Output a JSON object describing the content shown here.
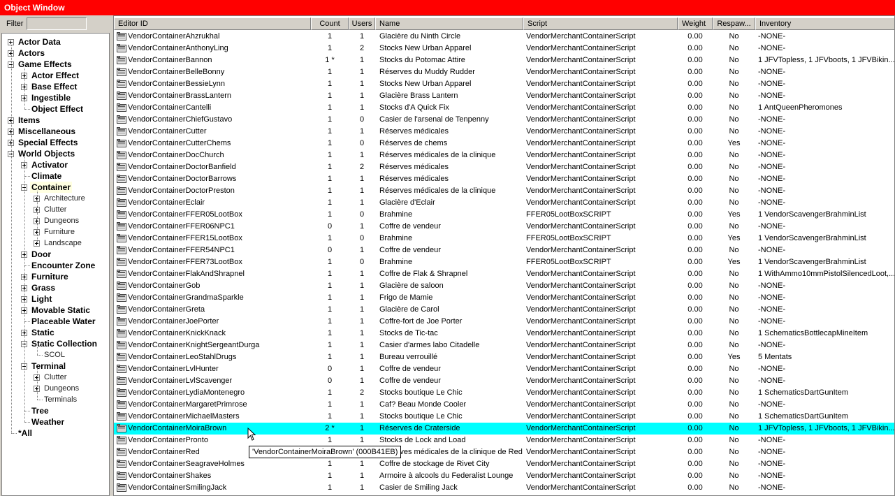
{
  "window": {
    "title": "Object Window"
  },
  "filter": {
    "label": "Filter",
    "value": ""
  },
  "tree": [
    {
      "label": "Actor Data",
      "level": 0,
      "expander": "plus"
    },
    {
      "label": "Actors",
      "level": 0,
      "expander": "plus"
    },
    {
      "label": "Game Effects",
      "level": 0,
      "expander": "minus"
    },
    {
      "label": "Actor Effect",
      "level": 1,
      "expander": "plus"
    },
    {
      "label": "Base Effect",
      "level": 1,
      "expander": "plus"
    },
    {
      "label": "Ingestible",
      "level": 1,
      "expander": "plus"
    },
    {
      "label": "Object Effect",
      "level": 1,
      "expander": "none"
    },
    {
      "label": "Items",
      "level": 0,
      "expander": "plus"
    },
    {
      "label": "Miscellaneous",
      "level": 0,
      "expander": "plus"
    },
    {
      "label": "Special Effects",
      "level": 0,
      "expander": "plus"
    },
    {
      "label": "World Objects",
      "level": 0,
      "expander": "minus"
    },
    {
      "label": "Activator",
      "level": 1,
      "expander": "plus"
    },
    {
      "label": "Climate",
      "level": 1,
      "expander": "none"
    },
    {
      "label": "Container",
      "level": 1,
      "expander": "minus",
      "selected": true
    },
    {
      "label": "Architecture",
      "level": 2,
      "expander": "plus"
    },
    {
      "label": "Clutter",
      "level": 2,
      "expander": "plus"
    },
    {
      "label": "Dungeons",
      "level": 2,
      "expander": "plus"
    },
    {
      "label": "Furniture",
      "level": 2,
      "expander": "plus"
    },
    {
      "label": "Landscape",
      "level": 2,
      "expander": "plus"
    },
    {
      "label": "Door",
      "level": 1,
      "expander": "plus"
    },
    {
      "label": "Encounter Zone",
      "level": 1,
      "expander": "none"
    },
    {
      "label": "Furniture",
      "level": 1,
      "expander": "plus"
    },
    {
      "label": "Grass",
      "level": 1,
      "expander": "plus"
    },
    {
      "label": "Light",
      "level": 1,
      "expander": "plus"
    },
    {
      "label": "Movable Static",
      "level": 1,
      "expander": "plus"
    },
    {
      "label": "Placeable Water",
      "level": 1,
      "expander": "none"
    },
    {
      "label": "Static",
      "level": 1,
      "expander": "plus"
    },
    {
      "label": "Static Collection",
      "level": 1,
      "expander": "minus"
    },
    {
      "label": "SCOL",
      "level": 2,
      "expander": "none"
    },
    {
      "label": "Terminal",
      "level": 1,
      "expander": "minus"
    },
    {
      "label": "Clutter",
      "level": 2,
      "expander": "plus"
    },
    {
      "label": "Dungeons",
      "level": 2,
      "expander": "plus"
    },
    {
      "label": "Terminals",
      "level": 2,
      "expander": "none"
    },
    {
      "label": "Tree",
      "level": 1,
      "expander": "none"
    },
    {
      "label": "Weather",
      "level": 1,
      "expander": "none"
    },
    {
      "label": "*All",
      "level": 0,
      "expander": "none"
    }
  ],
  "columns": [
    "Editor ID",
    "Count",
    "Users",
    "Name",
    "Script",
    "Weight",
    "Respaw...",
    "Inventory"
  ],
  "rows": [
    [
      "VendorContainerAhzrukhal",
      "1",
      "1",
      "Glacière du Ninth Circle",
      "VendorMerchantContainerScript",
      "0.00",
      "No",
      "-NONE-"
    ],
    [
      "VendorContainerAnthonyLing",
      "1",
      "2",
      "Stocks New Urban Apparel",
      "VendorMerchantContainerScript",
      "0.00",
      "No",
      "-NONE-"
    ],
    [
      "VendorContainerBannon",
      "1 *",
      "1",
      "Stocks du Potomac Attire",
      "VendorMerchantContainerScript",
      "0.00",
      "No",
      "1 JFVTopless, 1 JFVboots, 1 JFVBikin..."
    ],
    [
      "VendorContainerBelleBonny",
      "1",
      "1",
      "Réserves du Muddy Rudder",
      "VendorMerchantContainerScript",
      "0.00",
      "No",
      "-NONE-"
    ],
    [
      "VendorContainerBessieLynn",
      "1",
      "1",
      "Stocks New Urban Apparel",
      "VendorMerchantContainerScript",
      "0.00",
      "No",
      "-NONE-"
    ],
    [
      "VendorContainerBrassLantern",
      "1",
      "1",
      "Glacière Brass Lantern",
      "VendorMerchantContainerScript",
      "0.00",
      "No",
      "-NONE-"
    ],
    [
      "VendorContainerCantelli",
      "1",
      "1",
      "Stocks d'A Quick Fix",
      "VendorMerchantContainerScript",
      "0.00",
      "No",
      "1 AntQueenPheromones"
    ],
    [
      "VendorContainerChiefGustavo",
      "1",
      "0",
      "Casier de l'arsenal de Tenpenny",
      "VendorMerchantContainerScript",
      "0.00",
      "No",
      "-NONE-"
    ],
    [
      "VendorContainerCutter",
      "1",
      "1",
      "Réserves médicales",
      "VendorMerchantContainerScript",
      "0.00",
      "No",
      "-NONE-"
    ],
    [
      "VendorContainerCutterChems",
      "1",
      "0",
      "Réserves de chems",
      "VendorMerchantContainerScript",
      "0.00",
      "Yes",
      "-NONE-"
    ],
    [
      "VendorContainerDocChurch",
      "1",
      "1",
      "Réserves médicales de la clinique",
      "VendorMerchantContainerScript",
      "0.00",
      "No",
      "-NONE-"
    ],
    [
      "VendorContainerDoctorBanfield",
      "1",
      "2",
      "Réserves médicales",
      "VendorMerchantContainerScript",
      "0.00",
      "No",
      "-NONE-"
    ],
    [
      "VendorContainerDoctorBarrows",
      "1",
      "1",
      "Réserves médicales",
      "VendorMerchantContainerScript",
      "0.00",
      "No",
      "-NONE-"
    ],
    [
      "VendorContainerDoctorPreston",
      "1",
      "1",
      "Réserves médicales de la clinique",
      "VendorMerchantContainerScript",
      "0.00",
      "No",
      "-NONE-"
    ],
    [
      "VendorContainerEclair",
      "1",
      "1",
      "Glacière d'Eclair",
      "VendorMerchantContainerScript",
      "0.00",
      "No",
      "-NONE-"
    ],
    [
      "VendorContainerFFER05LootBox",
      "1",
      "0",
      "Brahmine",
      "FFER05LootBoxSCRIPT",
      "0.00",
      "Yes",
      "1 VendorScavengerBrahminList"
    ],
    [
      "VendorContainerFFER06NPC1",
      "0",
      "1",
      "Coffre de vendeur",
      "VendorMerchantContainerScript",
      "0.00",
      "No",
      "-NONE-"
    ],
    [
      "VendorContainerFFER15LootBox",
      "1",
      "0",
      "Brahmine",
      "FFER05LootBoxSCRIPT",
      "0.00",
      "Yes",
      "1 VendorScavengerBrahminList"
    ],
    [
      "VendorContainerFFER54NPC1",
      "0",
      "1",
      "Coffre de vendeur",
      "VendorMerchantContainerScript",
      "0.00",
      "No",
      "-NONE-"
    ],
    [
      "VendorContainerFFER73LootBox",
      "1",
      "0",
      "Brahmine",
      "FFER05LootBoxSCRIPT",
      "0.00",
      "Yes",
      "1 VendorScavengerBrahminList"
    ],
    [
      "VendorContainerFlakAndShrapnel",
      "1",
      "1",
      "Coffre de Flak & Shrapnel",
      "VendorMerchantContainerScript",
      "0.00",
      "No",
      "1 WithAmmo10mmPistolSilencedLoot,..."
    ],
    [
      "VendorContainerGob",
      "1",
      "1",
      "Glacière de saloon",
      "VendorMerchantContainerScript",
      "0.00",
      "No",
      "-NONE-"
    ],
    [
      "VendorContainerGrandmaSparkle",
      "1",
      "1",
      "Frigo de Mamie",
      "VendorMerchantContainerScript",
      "0.00",
      "No",
      "-NONE-"
    ],
    [
      "VendorContainerGreta",
      "1",
      "1",
      "Glacière de Carol",
      "VendorMerchantContainerScript",
      "0.00",
      "No",
      "-NONE-"
    ],
    [
      "VendorContainerJoePorter",
      "1",
      "1",
      "Coffre-fort de Joe Porter",
      "VendorMerchantContainerScript",
      "0.00",
      "No",
      "-NONE-"
    ],
    [
      "VendorContainerKnickKnack",
      "1",
      "1",
      "Stocks de Tic-tac",
      "VendorMerchantContainerScript",
      "0.00",
      "No",
      "1 SchematicsBottlecapMineItem"
    ],
    [
      "VendorContainerKnightSergeantDurga",
      "1",
      "1",
      "Casier d'armes labo Citadelle",
      "VendorMerchantContainerScript",
      "0.00",
      "No",
      "-NONE-"
    ],
    [
      "VendorContainerLeoStahlDrugs",
      "1",
      "1",
      "Bureau verrouillé",
      "VendorMerchantContainerScript",
      "0.00",
      "Yes",
      "5 Mentats"
    ],
    [
      "VendorContainerLvlHunter",
      "0",
      "1",
      "Coffre de vendeur",
      "VendorMerchantContainerScript",
      "0.00",
      "No",
      "-NONE-"
    ],
    [
      "VendorContainerLvlScavenger",
      "0",
      "1",
      "Coffre de vendeur",
      "VendorMerchantContainerScript",
      "0.00",
      "No",
      "-NONE-"
    ],
    [
      "VendorContainerLydiaMontenegro",
      "1",
      "2",
      "Stocks boutique Le Chic",
      "VendorMerchantContainerScript",
      "0.00",
      "No",
      "1 SchematicsDartGunItem"
    ],
    [
      "VendorContainerMargaretPrimrose",
      "1",
      "1",
      "Caf? Beau Monde Cooler",
      "VendorMerchantContainerScript",
      "0.00",
      "No",
      "-NONE-"
    ],
    [
      "VendorContainerMichaelMasters",
      "1",
      "1",
      "Stocks boutique Le Chic",
      "VendorMerchantContainerScript",
      "0.00",
      "No",
      "1 SchematicsDartGunItem"
    ],
    [
      "VendorContainerMoiraBrown",
      "2 *",
      "1",
      "Réserves de Craterside",
      "VendorMerchantContainerScript",
      "0.00",
      "No",
      "1 JFVTopless, 1 JFVboots, 1 JFVBikin..."
    ],
    [
      "VendorContainerPronto",
      "1",
      "1",
      "Stocks de Lock and Load",
      "VendorMerchantContainerScript",
      "0.00",
      "No",
      "-NONE-"
    ],
    [
      "VendorContainerRed",
      "1",
      "1",
      "Réserves médicales de la clinique de Red",
      "VendorMerchantContainerScript",
      "0.00",
      "No",
      "-NONE-"
    ],
    [
      "VendorContainerSeagraveHolmes",
      "1",
      "1",
      "Coffre de stockage de Rivet City",
      "VendorMerchantContainerScript",
      "0.00",
      "No",
      "-NONE-"
    ],
    [
      "VendorContainerShakes",
      "1",
      "1",
      "Armoire à alcools du Federalist Lounge",
      "VendorMerchantContainerScript",
      "0.00",
      "No",
      "-NONE-"
    ],
    [
      "VendorContainerSmilingJack",
      "1",
      "1",
      "Casier de Smiling Jack",
      "VendorMerchantContainerScript",
      "0.00",
      "No",
      "-NONE-"
    ]
  ],
  "selected_row": 33,
  "tooltip": "'VendorContainerMoiraBrown' (000B41EB)",
  "colors": {
    "titlebar": "#ff0000",
    "selection": "#00ffff",
    "chrome": "#d4d0c8"
  },
  "icons": {
    "row": "container-icon",
    "cursor": "mouse-pointer-icon"
  }
}
